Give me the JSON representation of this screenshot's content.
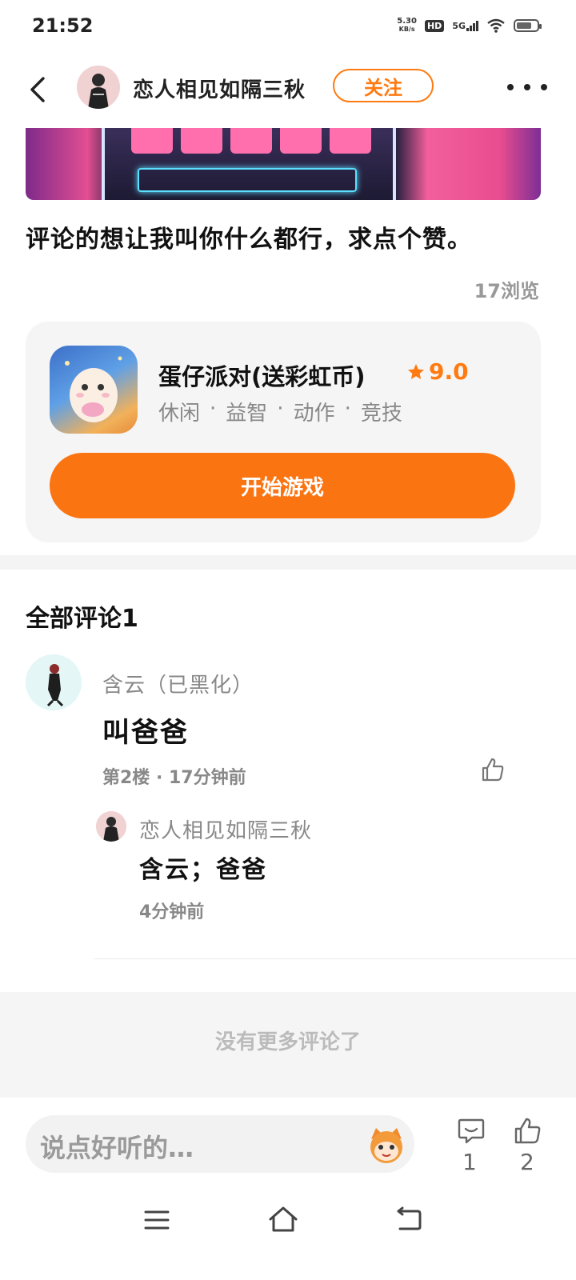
{
  "status_bar": {
    "time": "21:52",
    "net_speed_value": "5.30",
    "net_speed_unit": "KB/s",
    "hd": "HD",
    "network": "5G",
    "battery_level": 0.75
  },
  "header": {
    "author_name": "恋人相见如隔三秋",
    "follow_label": "关注"
  },
  "post": {
    "text": "评论的想让我叫你什么都行，求点个赞。",
    "views": "17浏览"
  },
  "game_card": {
    "title": "蛋仔派对(送彩虹币)",
    "rating": "9.0",
    "tags": [
      "休闲",
      "·",
      "益智",
      "·",
      "动作",
      "·",
      "竞技"
    ],
    "button_label": "开始游戏",
    "accent_color": "#fb7412"
  },
  "comments": {
    "title": "全部评论1",
    "items": [
      {
        "name": "含云（已黑化）",
        "text": "叫爸爸",
        "meta": "第2楼 · 17分钟前",
        "replies": [
          {
            "name": "恋人相见如隔三秋",
            "text": "含云；爸爸",
            "time": "4分钟前"
          }
        ]
      }
    ],
    "no_more": "没有更多评论了"
  },
  "bottom_bar": {
    "input_placeholder": "说点好听的…",
    "comment_count": "1",
    "like_count": "2"
  }
}
